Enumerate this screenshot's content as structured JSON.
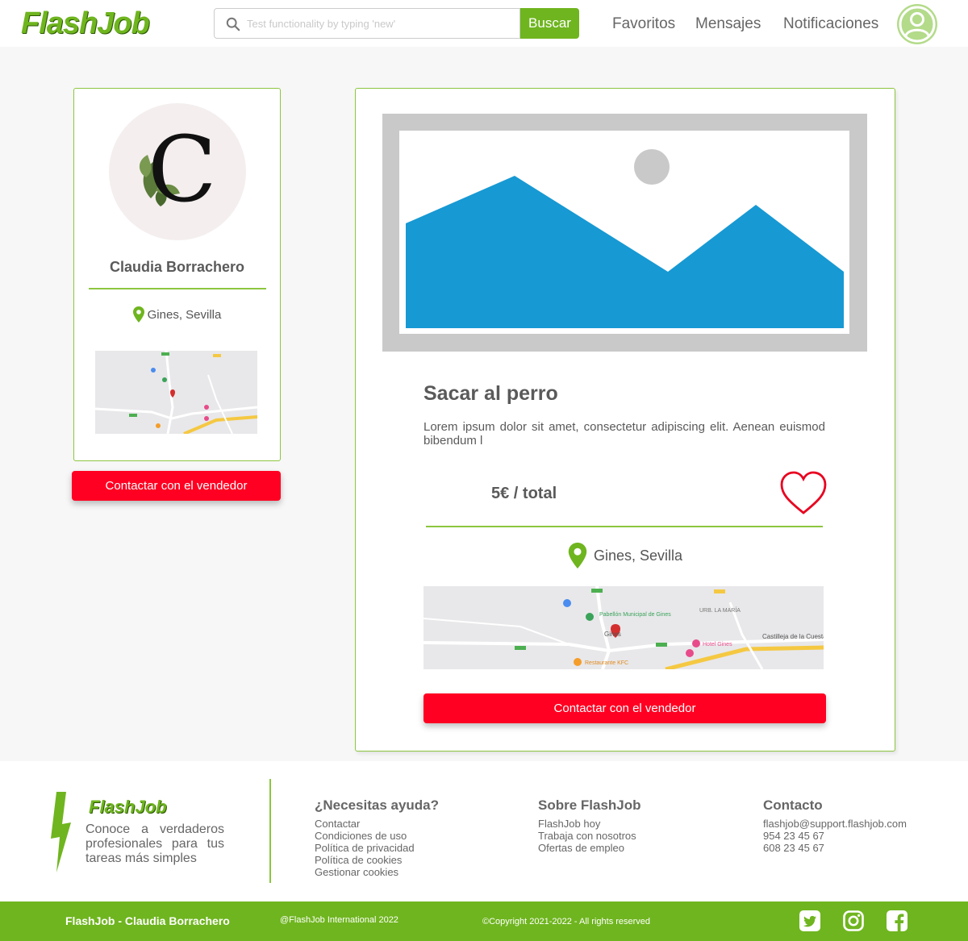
{
  "header": {
    "logo": "FlashJob",
    "search_placeholder": "Test functionality by typing 'new'",
    "search_button": "Buscar",
    "nav": [
      "Favoritos",
      "Mensajes",
      "Notificaciones"
    ]
  },
  "seller": {
    "avatar_letter": "C",
    "name": "Claudia Borrachero",
    "location": "Gines, Sevilla",
    "contact_button": "Contactar con el vendedor"
  },
  "job": {
    "title": "Sacar al perro",
    "description": "Lorem ipsum dolor sit amet, consectetur adipiscing elit. Aenean euismod bibendum l",
    "price": "5€ / total",
    "location": "Gines, Sevilla",
    "contact_button": "Contactar con el vendedor"
  },
  "map_labels_big": [
    "Pabellón Municipal de Gines",
    "URB. LA MARÍA",
    "Gines",
    "Castilleja de la Cuesta",
    "Hotel Gines",
    "Restaurante KFC"
  ],
  "footer": {
    "logo": "FlashJob",
    "tagline": "Conoce a verdaderos profesionales para tus tareas más simples",
    "help": {
      "title": "¿Necesitas ayuda?",
      "links": [
        "Contactar",
        "Condiciones de uso",
        "Política de privacidad",
        "Política de cookies",
        "Gestionar cookies"
      ]
    },
    "about": {
      "title": "Sobre FlashJob",
      "links": [
        "FlashJob hoy",
        "Trabaja con nosotros",
        "Ofertas de empleo"
      ]
    },
    "contact": {
      "title": "Contacto",
      "lines": [
        "flashjob@support.flashjob.com",
        "954 23 45 67",
        "608 23 45 67"
      ]
    }
  },
  "bottom_bar": {
    "brand": "FlashJob - Claudia Borrachero",
    "handle": "@FlashJob International 2022",
    "copyright": "©Copyright  2021-2022 - All rights reserved"
  },
  "colors": {
    "brand_green": "#6fb51f",
    "accent_red": "#ff0022",
    "image_blue": "#1799d3"
  }
}
